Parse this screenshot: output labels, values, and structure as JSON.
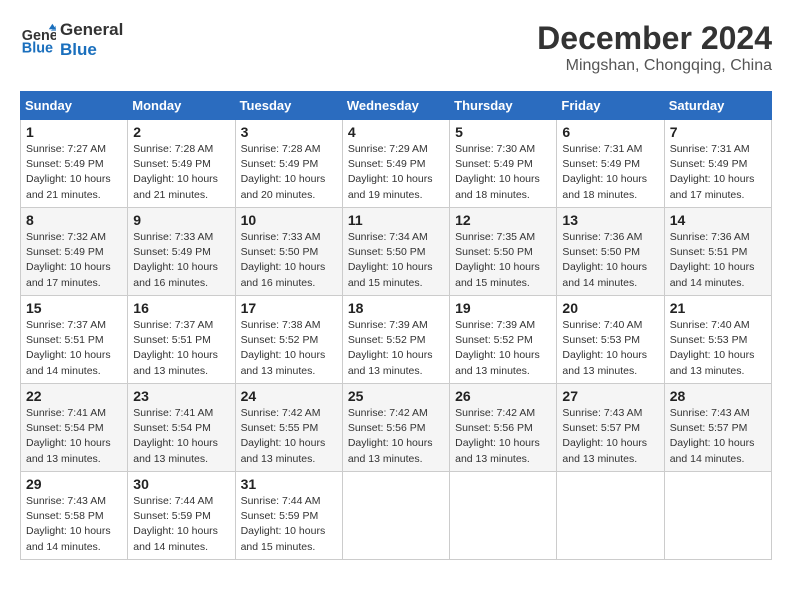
{
  "header": {
    "logo_line1": "General",
    "logo_line2": "Blue",
    "month": "December 2024",
    "location": "Mingshan, Chongqing, China"
  },
  "weekdays": [
    "Sunday",
    "Monday",
    "Tuesday",
    "Wednesday",
    "Thursday",
    "Friday",
    "Saturday"
  ],
  "weeks": [
    [
      {
        "day": "1",
        "sunrise": "7:27 AM",
        "sunset": "5:49 PM",
        "daylight": "10 hours and 21 minutes."
      },
      {
        "day": "2",
        "sunrise": "7:28 AM",
        "sunset": "5:49 PM",
        "daylight": "10 hours and 21 minutes."
      },
      {
        "day": "3",
        "sunrise": "7:28 AM",
        "sunset": "5:49 PM",
        "daylight": "10 hours and 20 minutes."
      },
      {
        "day": "4",
        "sunrise": "7:29 AM",
        "sunset": "5:49 PM",
        "daylight": "10 hours and 19 minutes."
      },
      {
        "day": "5",
        "sunrise": "7:30 AM",
        "sunset": "5:49 PM",
        "daylight": "10 hours and 18 minutes."
      },
      {
        "day": "6",
        "sunrise": "7:31 AM",
        "sunset": "5:49 PM",
        "daylight": "10 hours and 18 minutes."
      },
      {
        "day": "7",
        "sunrise": "7:31 AM",
        "sunset": "5:49 PM",
        "daylight": "10 hours and 17 minutes."
      }
    ],
    [
      {
        "day": "8",
        "sunrise": "7:32 AM",
        "sunset": "5:49 PM",
        "daylight": "10 hours and 17 minutes."
      },
      {
        "day": "9",
        "sunrise": "7:33 AM",
        "sunset": "5:49 PM",
        "daylight": "10 hours and 16 minutes."
      },
      {
        "day": "10",
        "sunrise": "7:33 AM",
        "sunset": "5:50 PM",
        "daylight": "10 hours and 16 minutes."
      },
      {
        "day": "11",
        "sunrise": "7:34 AM",
        "sunset": "5:50 PM",
        "daylight": "10 hours and 15 minutes."
      },
      {
        "day": "12",
        "sunrise": "7:35 AM",
        "sunset": "5:50 PM",
        "daylight": "10 hours and 15 minutes."
      },
      {
        "day": "13",
        "sunrise": "7:36 AM",
        "sunset": "5:50 PM",
        "daylight": "10 hours and 14 minutes."
      },
      {
        "day": "14",
        "sunrise": "7:36 AM",
        "sunset": "5:51 PM",
        "daylight": "10 hours and 14 minutes."
      }
    ],
    [
      {
        "day": "15",
        "sunrise": "7:37 AM",
        "sunset": "5:51 PM",
        "daylight": "10 hours and 14 minutes."
      },
      {
        "day": "16",
        "sunrise": "7:37 AM",
        "sunset": "5:51 PM",
        "daylight": "10 hours and 13 minutes."
      },
      {
        "day": "17",
        "sunrise": "7:38 AM",
        "sunset": "5:52 PM",
        "daylight": "10 hours and 13 minutes."
      },
      {
        "day": "18",
        "sunrise": "7:39 AM",
        "sunset": "5:52 PM",
        "daylight": "10 hours and 13 minutes."
      },
      {
        "day": "19",
        "sunrise": "7:39 AM",
        "sunset": "5:52 PM",
        "daylight": "10 hours and 13 minutes."
      },
      {
        "day": "20",
        "sunrise": "7:40 AM",
        "sunset": "5:53 PM",
        "daylight": "10 hours and 13 minutes."
      },
      {
        "day": "21",
        "sunrise": "7:40 AM",
        "sunset": "5:53 PM",
        "daylight": "10 hours and 13 minutes."
      }
    ],
    [
      {
        "day": "22",
        "sunrise": "7:41 AM",
        "sunset": "5:54 PM",
        "daylight": "10 hours and 13 minutes."
      },
      {
        "day": "23",
        "sunrise": "7:41 AM",
        "sunset": "5:54 PM",
        "daylight": "10 hours and 13 minutes."
      },
      {
        "day": "24",
        "sunrise": "7:42 AM",
        "sunset": "5:55 PM",
        "daylight": "10 hours and 13 minutes."
      },
      {
        "day": "25",
        "sunrise": "7:42 AM",
        "sunset": "5:56 PM",
        "daylight": "10 hours and 13 minutes."
      },
      {
        "day": "26",
        "sunrise": "7:42 AM",
        "sunset": "5:56 PM",
        "daylight": "10 hours and 13 minutes."
      },
      {
        "day": "27",
        "sunrise": "7:43 AM",
        "sunset": "5:57 PM",
        "daylight": "10 hours and 13 minutes."
      },
      {
        "day": "28",
        "sunrise": "7:43 AM",
        "sunset": "5:57 PM",
        "daylight": "10 hours and 14 minutes."
      }
    ],
    [
      {
        "day": "29",
        "sunrise": "7:43 AM",
        "sunset": "5:58 PM",
        "daylight": "10 hours and 14 minutes."
      },
      {
        "day": "30",
        "sunrise": "7:44 AM",
        "sunset": "5:59 PM",
        "daylight": "10 hours and 14 minutes."
      },
      {
        "day": "31",
        "sunrise": "7:44 AM",
        "sunset": "5:59 PM",
        "daylight": "10 hours and 15 minutes."
      },
      null,
      null,
      null,
      null
    ]
  ],
  "labels": {
    "sunrise": "Sunrise:",
    "sunset": "Sunset:",
    "daylight": "Daylight:"
  }
}
